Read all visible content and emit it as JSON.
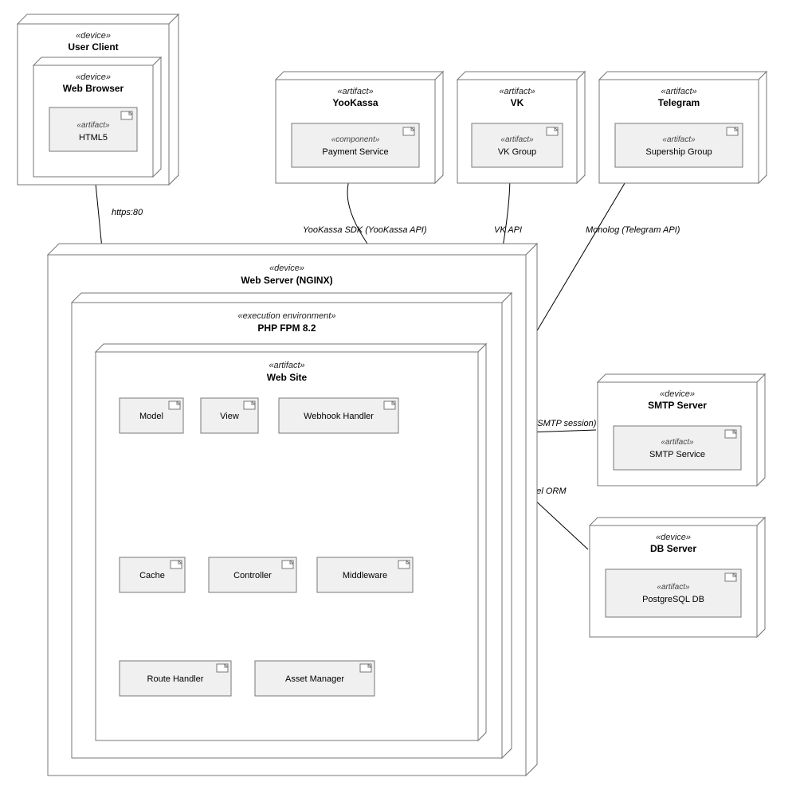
{
  "diagram_type": "UML Deployment Diagram",
  "nodes": {
    "userClient": {
      "stereotype": "«device»",
      "name": "User Client"
    },
    "webBrowser": {
      "stereotype": "«device»",
      "name": "Web Browser"
    },
    "html5": {
      "stereotype": "«artifact»",
      "name": "HTML5"
    },
    "yookassa": {
      "stereotype": "«artifact»",
      "name": "YooKassa"
    },
    "paymentSvc": {
      "stereotype": "«component»",
      "name": "Payment Service"
    },
    "vk": {
      "stereotype": "«artifact»",
      "name": "VK"
    },
    "vkGroup": {
      "stereotype": "«artifact»",
      "name": "VK Group"
    },
    "telegram": {
      "stereotype": "«artifact»",
      "name": "Telegram"
    },
    "supership": {
      "stereotype": "«artifact»",
      "name": "Supership Group"
    },
    "webServer": {
      "stereotype": "«device»",
      "name": "Web Server (NGINX)"
    },
    "phpfpm": {
      "stereotype": "«execution environment»",
      "name": "PHP FPM 8.2"
    },
    "webSite": {
      "stereotype": "«artifact»",
      "name": "Web Site"
    },
    "model": {
      "name": "Model"
    },
    "view": {
      "name": "View"
    },
    "webhook": {
      "name": "Webhook Handler"
    },
    "cache": {
      "name": "Cache"
    },
    "controller": {
      "name": "Controller"
    },
    "middleware": {
      "name": "Middleware"
    },
    "routeHandler": {
      "name": "Route Handler"
    },
    "assetManager": {
      "name": "Asset Manager"
    },
    "smtpServer": {
      "stereotype": "«device»",
      "name": "SMTP Server"
    },
    "smtpService": {
      "stereotype": "«artifact»",
      "name": "SMTP Service"
    },
    "dbServer": {
      "stereotype": "«device»",
      "name": "DB Server"
    },
    "postgres": {
      "stereotype": "«artifact»",
      "name": "PostgreSQL DB"
    }
  },
  "edges": {
    "https": {
      "label": "https:80"
    },
    "yookSDK": {
      "label": "YooKassa SDK (YooKassa API)"
    },
    "vkapi": {
      "label": "VK API"
    },
    "monolog": {
      "label": "Monolog (Telegram API)"
    },
    "phpmailer": {
      "label": "PhpMailer (SMTP session)"
    },
    "propel": {
      "label": "Propel ORM"
    }
  }
}
